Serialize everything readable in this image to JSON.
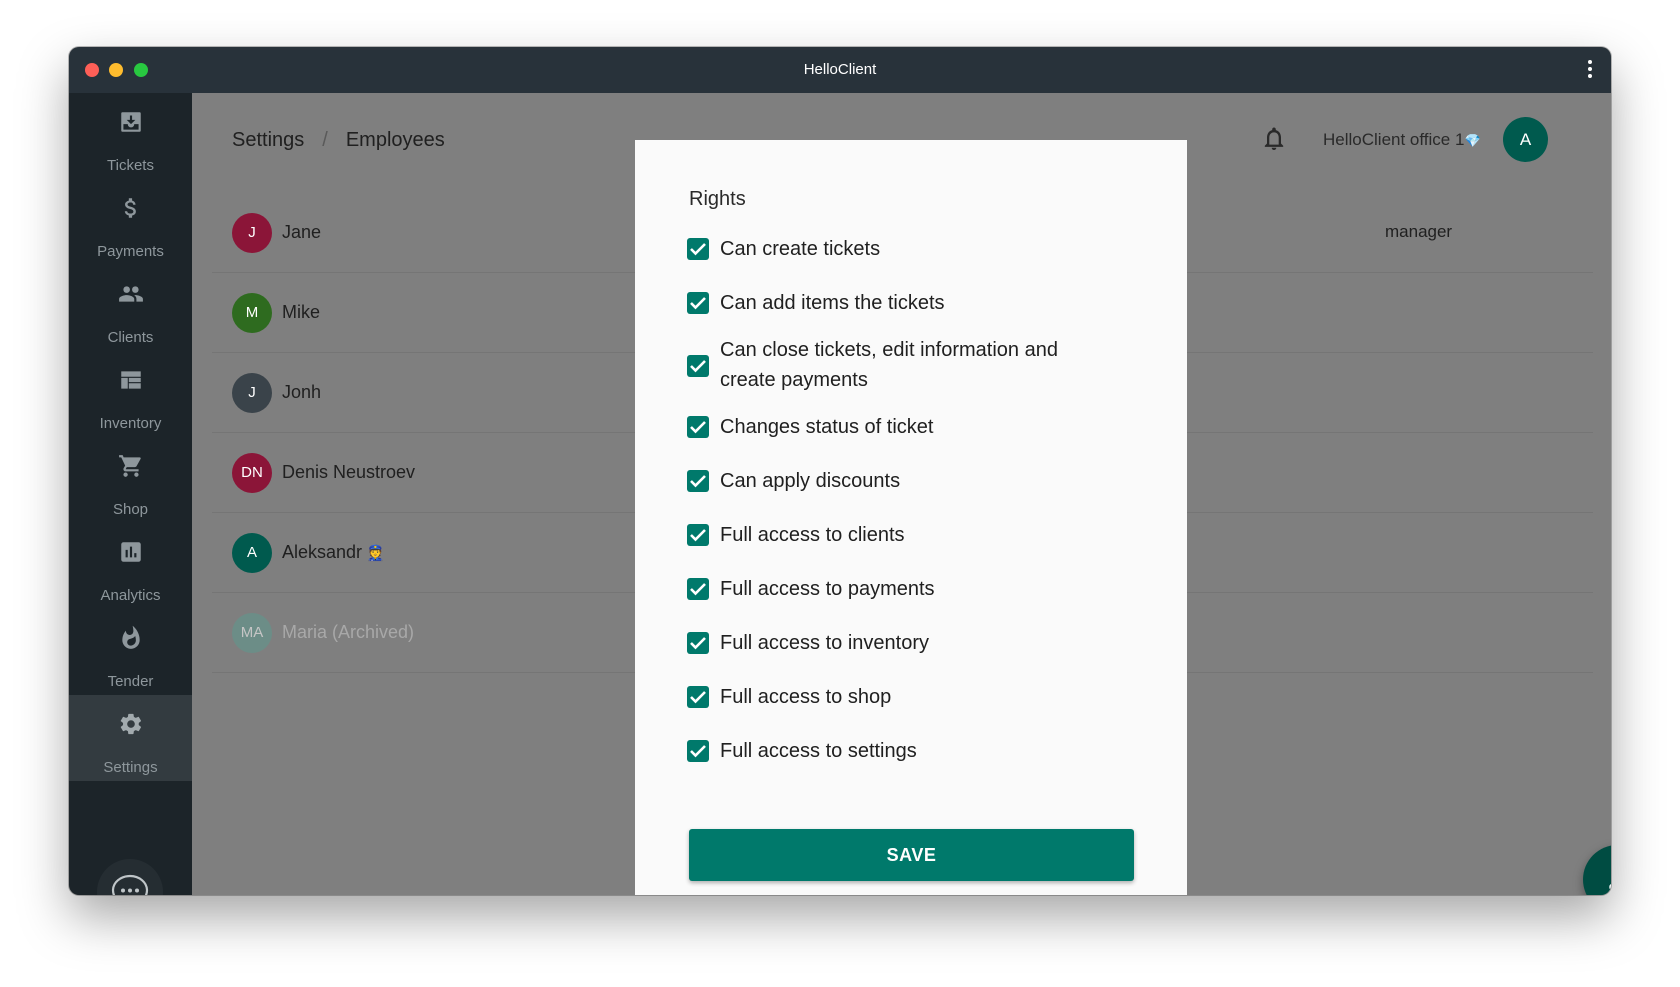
{
  "window": {
    "title": "HelloClient"
  },
  "sidebar": {
    "items": [
      {
        "label": "Tickets",
        "icon": "ticket-icon"
      },
      {
        "label": "Payments",
        "icon": "dollar-icon"
      },
      {
        "label": "Clients",
        "icon": "people-icon"
      },
      {
        "label": "Inventory",
        "icon": "inventory-icon"
      },
      {
        "label": "Shop",
        "icon": "cart-icon"
      },
      {
        "label": "Analytics",
        "icon": "chart-icon"
      },
      {
        "label": "Tender",
        "icon": "flame-icon"
      },
      {
        "label": "Settings",
        "icon": "gear-icon",
        "active": true
      }
    ],
    "chat_icon": "chat-bubble-icon"
  },
  "header": {
    "breadcrumb": {
      "root": "Settings",
      "separator": "/",
      "current": "Employees"
    },
    "office_name": "HelloClient office 1",
    "office_badge": "💎",
    "avatar_initial": "A"
  },
  "employees": [
    {
      "initials": "J",
      "name": "Jane",
      "role": "manager",
      "color": "#8b1538",
      "archived": false
    },
    {
      "initials": "M",
      "name": "Mike",
      "role": "",
      "color": "#2e6b1f",
      "archived": false
    },
    {
      "initials": "J",
      "name": "Jonh",
      "role": "",
      "color": "#3a434a",
      "archived": false
    },
    {
      "initials": "DN",
      "name": "Denis Neustroev",
      "role": "",
      "color": "#8b1538",
      "archived": false
    },
    {
      "initials": "A",
      "name": "Aleksandr",
      "badge": "👮",
      "role": "",
      "color": "#005a4e",
      "archived": false
    },
    {
      "initials": "MA",
      "name": "Maria (Archived)",
      "role": "",
      "color": "#5d9a8f",
      "archived": true
    }
  ],
  "dialog": {
    "title": "Rights",
    "permissions": [
      {
        "label": "Can create tickets",
        "checked": true
      },
      {
        "label": "Can add items the tickets",
        "checked": true
      },
      {
        "label": "Can close tickets, edit information and",
        "label_line2": "create payments",
        "checked": true
      },
      {
        "label": "Changes status of ticket",
        "checked": true
      },
      {
        "label": "Can apply discounts",
        "checked": true
      },
      {
        "label": "Full access to clients",
        "checked": true
      },
      {
        "label": "Full access to payments",
        "checked": true
      },
      {
        "label": "Full access to inventory",
        "checked": true
      },
      {
        "label": "Full access to shop",
        "checked": true
      },
      {
        "label": "Full access to settings",
        "checked": true
      }
    ],
    "save_label": "SAVE"
  },
  "colors": {
    "accent": "#00796b",
    "sidebar": "#1c2429",
    "titlebar": "#28323a"
  }
}
